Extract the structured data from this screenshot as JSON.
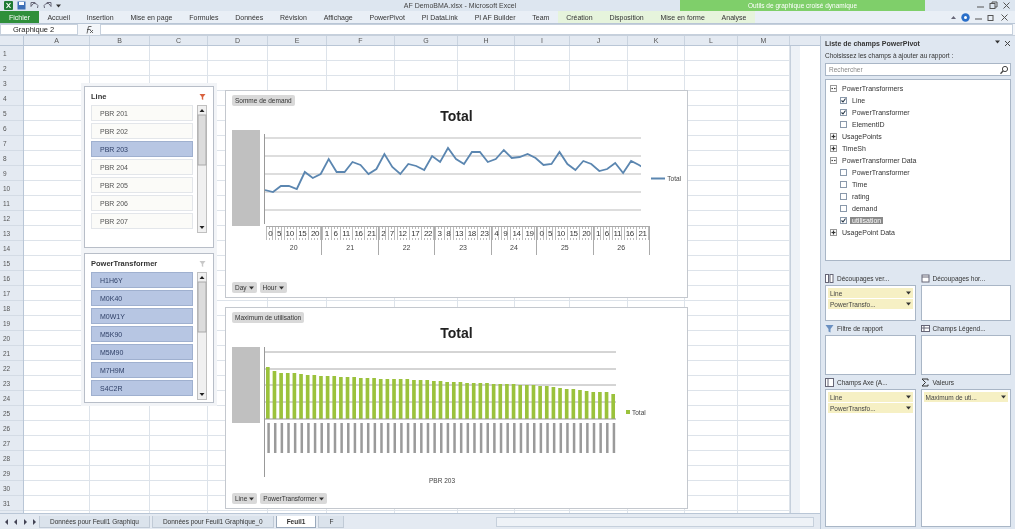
{
  "window": {
    "title": "AF DemoBMA.xlsx - Microsoft Excel",
    "context_group": "Outils de graphique croisé dynamique"
  },
  "ribbon_tabs": [
    {
      "label": "Fichier",
      "kind": "file"
    },
    {
      "label": "Accueil",
      "kind": "tab"
    },
    {
      "label": "Insertion",
      "kind": "tab"
    },
    {
      "label": "Mise en page",
      "kind": "tab"
    },
    {
      "label": "Formules",
      "kind": "tab"
    },
    {
      "label": "Données",
      "kind": "tab"
    },
    {
      "label": "Révision",
      "kind": "tab"
    },
    {
      "label": "Affichage",
      "kind": "tab"
    },
    {
      "label": "PowerPivot",
      "kind": "tab"
    },
    {
      "label": "PI DataLink",
      "kind": "tab"
    },
    {
      "label": "PI AF Builder",
      "kind": "tab"
    },
    {
      "label": "Team",
      "kind": "tab"
    },
    {
      "label": "Création",
      "kind": "context"
    },
    {
      "label": "Disposition",
      "kind": "context"
    },
    {
      "label": "Mise en forme",
      "kind": "context"
    },
    {
      "label": "Analyse",
      "kind": "context"
    }
  ],
  "formula_bar": {
    "name_box": "Graphique 2"
  },
  "sheet": {
    "columns": [
      "A",
      "B",
      "C",
      "D",
      "E",
      "F",
      "G",
      "H",
      "I",
      "J",
      "K",
      "L",
      "M"
    ],
    "rows": [
      "1",
      "2",
      "3",
      "4",
      "5",
      "6",
      "7",
      "8",
      "9",
      "10",
      "11",
      "12",
      "13",
      "14",
      "15",
      "16",
      "17",
      "18",
      "19",
      "20",
      "21",
      "22",
      "23",
      "24",
      "25",
      "26",
      "27",
      "28",
      "29",
      "30",
      "31"
    ]
  },
  "slicers": [
    {
      "title": "Line",
      "filtered": true,
      "items": [
        {
          "label": "PBR 201",
          "selected": false
        },
        {
          "label": "PBR 202",
          "selected": false
        },
        {
          "label": "PBR 203",
          "selected": true
        },
        {
          "label": "PBR 204",
          "selected": false
        },
        {
          "label": "PBR 205",
          "selected": false
        },
        {
          "label": "PBR 206",
          "selected": false
        },
        {
          "label": "PBR 207",
          "selected": false
        }
      ]
    },
    {
      "title": "PowerTransformer",
      "filtered": false,
      "items": [
        {
          "label": "H1H6Y",
          "selected": true
        },
        {
          "label": "M0K40",
          "selected": true
        },
        {
          "label": "M0W1Y",
          "selected": true
        },
        {
          "label": "M5K90",
          "selected": true
        },
        {
          "label": "M5M90",
          "selected": true
        },
        {
          "label": "M7H9M",
          "selected": true
        },
        {
          "label": "S4C2R",
          "selected": true
        }
      ]
    }
  ],
  "charts": [
    {
      "kind": "line",
      "field_button": "Somme de demand",
      "title": "Total",
      "legend": "Total",
      "days": [
        {
          "label": "20",
          "hours": [
            "0",
            "5",
            "10",
            "15",
            "20"
          ]
        },
        {
          "label": "21",
          "hours": [
            "1",
            "6",
            "11",
            "16",
            "21"
          ]
        },
        {
          "label": "22",
          "hours": [
            "2",
            "7",
            "12",
            "17",
            "22"
          ]
        },
        {
          "label": "23",
          "hours": [
            "3",
            "8",
            "13",
            "18",
            "23"
          ]
        },
        {
          "label": "24",
          "hours": [
            "4",
            "9",
            "14",
            "19"
          ]
        },
        {
          "label": "25",
          "hours": [
            "0",
            "5",
            "10",
            "15",
            "20"
          ]
        },
        {
          "label": "26",
          "hours": [
            "1",
            "6",
            "11",
            "16",
            "21"
          ]
        }
      ],
      "axis_buttons": [
        "Day",
        "Hour"
      ]
    },
    {
      "kind": "bar",
      "field_button": "Maximum de utilisation",
      "title": "Total",
      "legend": "Total",
      "axis_title": "PBR 203",
      "axis_buttons": [
        "Line",
        "PowerTransformer"
      ]
    }
  ],
  "sheet_tabs": [
    {
      "label": "Données pour Feuil1 Graphiqu",
      "selected": false
    },
    {
      "label": "Données pour Feuil1 Graphique_0",
      "selected": false
    },
    {
      "label": "Feuil1",
      "selected": true
    },
    {
      "label": "F",
      "selected": false
    }
  ],
  "field_list": {
    "title": "Liste de champs PowerPivot",
    "prompt": "Choisissez les champs à ajouter au rapport :",
    "search": {
      "placeholder": "Rechercher"
    },
    "tree": [
      {
        "label": "PowerTransformers",
        "expanded": true,
        "children": [
          {
            "label": "Line",
            "checked": true,
            "selected": false
          },
          {
            "label": "PowerTransformer",
            "checked": true,
            "selected": false
          },
          {
            "label": "ElementID",
            "checked": false,
            "selected": false
          }
        ]
      },
      {
        "label": "UsagePoints",
        "expanded": false
      },
      {
        "label": "TimeSh",
        "expanded": false
      },
      {
        "label": "PowerTransformer Data",
        "expanded": true,
        "children": [
          {
            "label": "PowerTransformer",
            "checked": false,
            "selected": false
          },
          {
            "label": "Time",
            "checked": false,
            "selected": false
          },
          {
            "label": "rating",
            "checked": false,
            "selected": false
          },
          {
            "label": "demand",
            "checked": false,
            "selected": false
          },
          {
            "label": "utilisation",
            "checked": true,
            "selected": true
          }
        ]
      },
      {
        "label": "UsagePoint Data",
        "expanded": false
      }
    ],
    "areas": [
      {
        "kind": "vertical-slicers",
        "title": "Découpages ver...",
        "fields": [
          "Line",
          "PowerTransfo..."
        ]
      },
      {
        "kind": "horizontal-slicers",
        "title": "Découpages hor..."
      },
      {
        "kind": "filter",
        "title": "Filtre de rapport"
      },
      {
        "kind": "legend",
        "title": "Champs Légend..."
      },
      {
        "kind": "axis",
        "title": "Champs Axe (A...",
        "fields": [
          "Line",
          "PowerTransfo..."
        ]
      },
      {
        "kind": "values",
        "title": "Valeurs",
        "fields": [
          "Maximum de uti..."
        ]
      }
    ]
  }
}
